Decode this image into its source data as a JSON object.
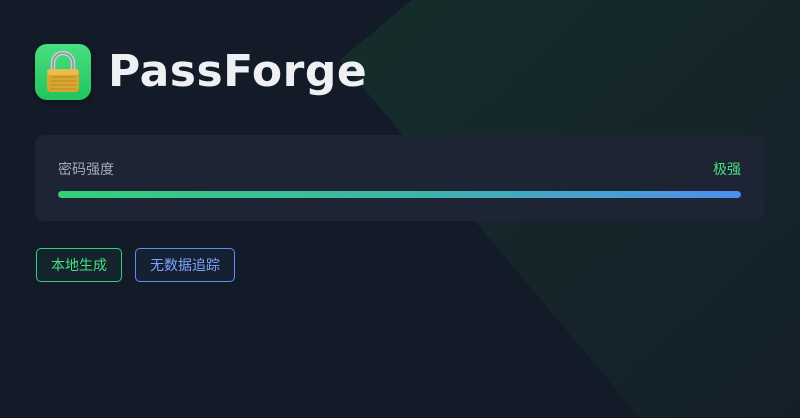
{
  "app": {
    "name": "PassForge",
    "icon": "lock-icon"
  },
  "strength": {
    "label": "密码强度",
    "level": "极强",
    "percent": 100
  },
  "badges": [
    {
      "label": "本地生成",
      "color": "#4ade80"
    },
    {
      "label": "无数据追踪",
      "color": "#7aa5ff"
    }
  ],
  "colors": {
    "background": "#131a28",
    "card": "#1d2535",
    "accent_green": "#4ade80",
    "accent_blue": "#4f8ff0"
  }
}
